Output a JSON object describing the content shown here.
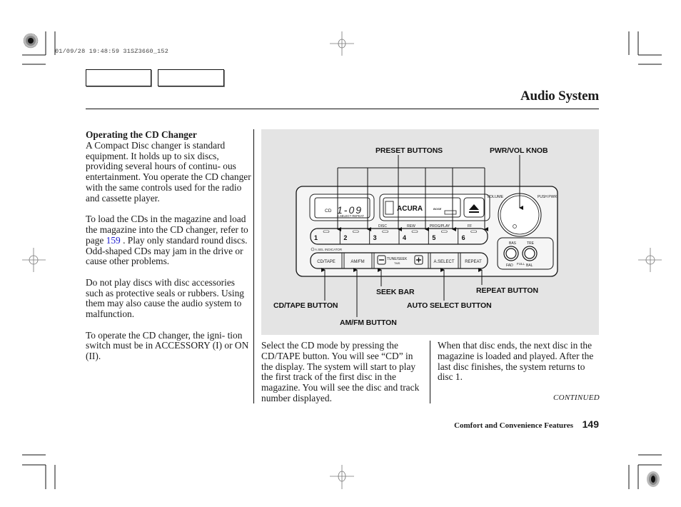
{
  "print_stamp": "01/09/28 19:48:59 31SZ3660_152",
  "header": {
    "title": "Audio System"
  },
  "left_column": {
    "heading": "Operating the CD Changer",
    "para1": "A Compact Disc changer is standard equipment. It holds up to six discs, providing several hours of continu- ous entertainment. You operate the CD changer with the same controls used for the radio and cassette player.",
    "para2_before_link": "To load the CDs in the magazine and load the magazine into the CD changer, refer to page ",
    "para2_link": "159",
    "para2_after_link": " . Play only standard round discs. Odd-shaped CDs may jam in the drive or cause other problems.",
    "para3": "Do not play discs with disc accessories such as protective seals or rubbers. Using them may also cause the audio system to malfunction.",
    "para4": "To operate the CD changer, the igni- tion switch must be in ACCESSORY (I) or ON (II)."
  },
  "figure": {
    "callouts": {
      "preset_buttons": "PRESET BUTTONS",
      "pwr_vol_knob": "PWR/VOL KNOB",
      "seek_bar": "SEEK BAR",
      "repeat_button": "REPEAT BUTTON",
      "cd_tape_button": "CD/TAPE BUTTON",
      "auto_select_button": "AUTO SELECT BUTTON",
      "am_fm_button": "AM/FM BUTTON"
    },
    "radio": {
      "display_mode": "CD",
      "display_value": "1-09",
      "display_sub": "A.SELECT  REPEAT",
      "brand": "ACURA",
      "sub_brand": "BOSE",
      "presets": [
        "1",
        "2",
        "3",
        "4",
        "5",
        "6"
      ],
      "preset_top_labels": [
        "",
        "",
        "DISC",
        "REW",
        "PROG/PLAY",
        "FF"
      ],
      "auto_select_indicator": "A.SEL INDICATOR",
      "row2_buttons": [
        "CD/TAPE",
        "AM/FM",
        "TUNE/SEEK",
        "A.SELECT",
        "REPEAT"
      ],
      "tune_sub": "TMS",
      "volume_label": "VOLUME",
      "push_pwr_label": "PUSH PWR",
      "bas_label": "BAS",
      "tre_label": "TRE",
      "fad_label": "FAD",
      "full_label": "FULL",
      "bal_label": "BAL"
    }
  },
  "middle_column": {
    "para": "Select the CD mode by pressing the CD/TAPE button. You will see “CD” in the display. The system will start to play the first track of the first disc in the magazine. You will see the disc and track number displayed."
  },
  "right_column": {
    "para": "When that disc ends, the next disc in the magazine is loaded and played. After the last disc finishes, the system returns to disc 1.",
    "continued": "CONTINUED"
  },
  "footer": {
    "section": "Comfort and Convenience Features",
    "page_number": "149"
  }
}
